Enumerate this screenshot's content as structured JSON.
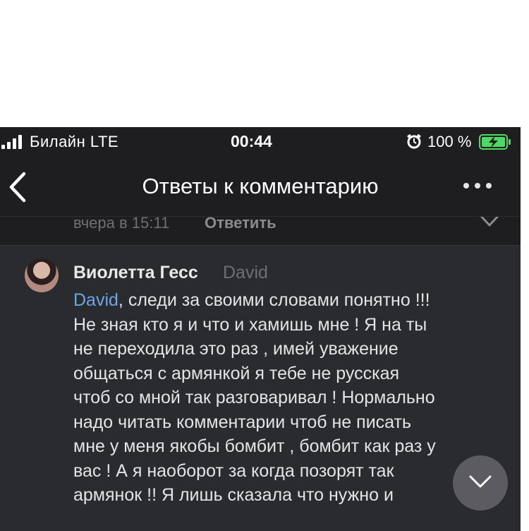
{
  "status_bar": {
    "carrier": "Билайн  LTE",
    "time": "00:44",
    "battery": "100 %"
  },
  "nav": {
    "title": "Ответы к комментарию",
    "back_icon": "chevron-left-icon",
    "more_icon": "more-horizontal-icon"
  },
  "previous_comment": {
    "time": "вчера в 15:11",
    "reply_label": "Ответить"
  },
  "comment": {
    "author": "Виолетта Гесс",
    "reply_to": "David",
    "mention": "David",
    "lines": [
      ", следи за своими словами понятно !!!",
      "Не зная кто я и что и хамишь мне ! Я на ты",
      "не переходила это раз , имей уважение",
      "общаться с армянкой я тебе не русская",
      "чтоб со мной так разговаривал ! Нормально",
      "надо читать комментарии чтоб не писать",
      "мне у меня якобы бомбит , бомбит как раз у",
      "вас !  А я наоборот за когда позорят так",
      "армянок !! Я лишь сказала что нужно и"
    ]
  },
  "colors": {
    "background": "#1e1e20",
    "highlight": "#2a2b2e",
    "mention": "#6aa6e8",
    "battery": "#4cd964"
  }
}
